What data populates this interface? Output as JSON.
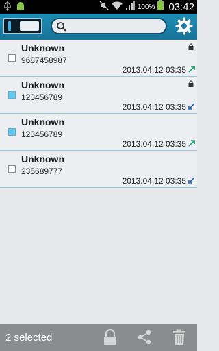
{
  "status": {
    "battery_pct": "100%",
    "time": "03:42"
  },
  "search": {
    "placeholder": ""
  },
  "entries": [
    {
      "name": "Unknown",
      "number": "9687458987",
      "date": "2013.04.12 03:35",
      "selected": false,
      "locked": true,
      "direction": "outgoing"
    },
    {
      "name": "Unknown",
      "number": "123456789",
      "date": "2013.04.12 03:35",
      "selected": true,
      "locked": true,
      "direction": "incoming"
    },
    {
      "name": "Unknown",
      "number": "123456789",
      "date": "2013.04.12 03:35",
      "selected": true,
      "locked": false,
      "direction": "outgoing"
    },
    {
      "name": "Unknown",
      "number": "235689777",
      "date": "2013.04.12 03:35",
      "selected": false,
      "locked": false,
      "direction": "incoming"
    }
  ],
  "bottom": {
    "selected_label": "2 selected"
  },
  "colors": {
    "accent": "#1a86ad",
    "checked": "#63c7f0",
    "outgoing": "#1fa36d",
    "incoming": "#1f5fa8"
  },
  "icons": [
    "usb-icon",
    "android-icon",
    "mute-icon",
    "wifi-icon",
    "signal-icon",
    "battery-icon",
    "search-icon",
    "gear-icon",
    "lock-icon",
    "share-icon",
    "trash-icon"
  ]
}
